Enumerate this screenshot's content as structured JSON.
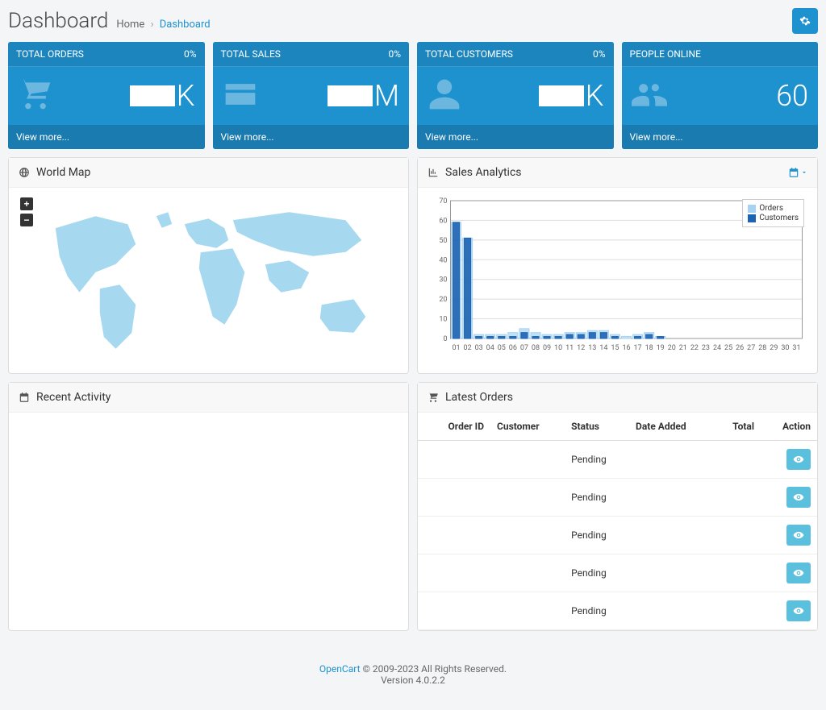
{
  "header": {
    "title": "Dashboard",
    "crumb_home": "Home",
    "crumb_current": "Dashboard"
  },
  "tiles": {
    "orders": {
      "label": "TOTAL ORDERS",
      "pct": "0%",
      "suffix": "K",
      "more": "View more..."
    },
    "sales": {
      "label": "TOTAL SALES",
      "pct": "0%",
      "suffix": "M",
      "more": "View more..."
    },
    "customers": {
      "label": "TOTAL CUSTOMERS",
      "pct": "0%",
      "suffix": "K",
      "more": "View more..."
    },
    "online": {
      "label": "PEOPLE ONLINE",
      "pct": "",
      "value": "60",
      "more": "View more..."
    }
  },
  "panels": {
    "map_title": "World Map",
    "sales_title": "Sales Analytics",
    "recent_title": "Recent Activity",
    "orders_title": "Latest Orders"
  },
  "orders_table": {
    "headers": {
      "id": "Order ID",
      "customer": "Customer",
      "status": "Status",
      "date": "Date Added",
      "total": "Total",
      "action": "Action"
    },
    "rows": [
      {
        "status": "Pending"
      },
      {
        "status": "Pending"
      },
      {
        "status": "Pending"
      },
      {
        "status": "Pending"
      },
      {
        "status": "Pending"
      }
    ]
  },
  "footer": {
    "brand": "OpenCart",
    "copy1": " © 2009-2023 All Rights Reserved.",
    "copy2": "Version 4.0.2.2"
  },
  "chart_data": {
    "type": "bar",
    "title": "Sales Analytics",
    "xlabel": "",
    "ylabel": "",
    "ylim": [
      0,
      70
    ],
    "yticks": [
      0,
      10,
      20,
      30,
      40,
      50,
      60,
      70
    ],
    "categories": [
      "01",
      "02",
      "03",
      "04",
      "05",
      "06",
      "07",
      "08",
      "09",
      "10",
      "11",
      "12",
      "13",
      "14",
      "15",
      "16",
      "17",
      "18",
      "19",
      "20",
      "21",
      "22",
      "23",
      "24",
      "25",
      "26",
      "27",
      "28",
      "29",
      "30",
      "31"
    ],
    "series": [
      {
        "name": "Orders",
        "color": "#a6d3f2",
        "values": [
          59,
          51,
          2,
          2,
          2,
          3,
          5,
          3,
          2,
          2,
          3,
          3,
          4,
          4,
          2,
          1,
          2,
          3,
          1,
          0,
          0,
          0,
          0,
          0,
          0,
          0,
          0,
          0,
          0,
          0,
          0
        ]
      },
      {
        "name": "Customers",
        "color": "#1d63b3",
        "values": [
          59,
          51,
          1,
          1,
          1,
          1,
          3,
          1,
          1,
          1,
          2,
          2,
          3,
          3,
          1,
          0,
          1,
          2,
          1,
          0,
          0,
          0,
          0,
          0,
          0,
          0,
          0,
          0,
          0,
          0,
          0
        ]
      }
    ]
  }
}
